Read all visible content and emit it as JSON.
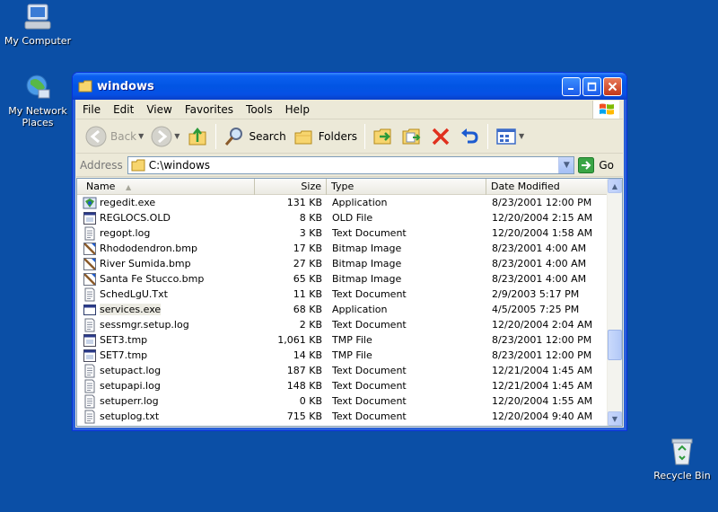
{
  "desktop": {
    "icons": [
      {
        "label": "My Computer"
      },
      {
        "label": "My Network Places"
      },
      {
        "label": "Recycle Bin"
      }
    ]
  },
  "window": {
    "title": "windows",
    "menu": [
      "File",
      "Edit",
      "View",
      "Favorites",
      "Tools",
      "Help"
    ],
    "toolbar": {
      "back_label": "Back",
      "search_label": "Search",
      "folders_label": "Folders"
    },
    "address": {
      "label": "Address",
      "value": "C:\\windows",
      "go_label": "Go"
    },
    "columns": [
      "Name",
      "Size",
      "Type",
      "Date Modified"
    ],
    "files": [
      {
        "name": "regedit.exe",
        "size": "131 KB",
        "type": "Application",
        "date": "8/23/2001 12:00 PM",
        "icon": "app-icon"
      },
      {
        "name": "REGLOCS.OLD",
        "size": "8 KB",
        "type": "OLD File",
        "date": "12/20/2004 2:15 AM",
        "icon": "file-icon"
      },
      {
        "name": "regopt.log",
        "size": "3 KB",
        "type": "Text Document",
        "date": "12/20/2004 1:58 AM",
        "icon": "text-file-icon"
      },
      {
        "name": "Rhododendron.bmp",
        "size": "17 KB",
        "type": "Bitmap Image",
        "date": "8/23/2001 4:00 AM",
        "icon": "bitmap-icon"
      },
      {
        "name": "River Sumida.bmp",
        "size": "27 KB",
        "type": "Bitmap Image",
        "date": "8/23/2001 4:00 AM",
        "icon": "bitmap-icon"
      },
      {
        "name": "Santa Fe Stucco.bmp",
        "size": "65 KB",
        "type": "Bitmap Image",
        "date": "8/23/2001 4:00 AM",
        "icon": "bitmap-icon"
      },
      {
        "name": "SchedLgU.Txt",
        "size": "11 KB",
        "type": "Text Document",
        "date": "2/9/2003 5:17 PM",
        "icon": "text-file-icon"
      },
      {
        "name": "services.exe",
        "size": "68 KB",
        "type": "Application",
        "date": "4/5/2005 7:25 PM",
        "icon": "window-app-icon"
      },
      {
        "name": "sessmgr.setup.log",
        "size": "2 KB",
        "type": "Text Document",
        "date": "12/20/2004 2:04 AM",
        "icon": "text-file-icon"
      },
      {
        "name": "SET3.tmp",
        "size": "1,061 KB",
        "type": "TMP File",
        "date": "8/23/2001 12:00 PM",
        "icon": "file-icon"
      },
      {
        "name": "SET7.tmp",
        "size": "14 KB",
        "type": "TMP File",
        "date": "8/23/2001 12:00 PM",
        "icon": "file-icon"
      },
      {
        "name": "setupact.log",
        "size": "187 KB",
        "type": "Text Document",
        "date": "12/21/2004 1:45 AM",
        "icon": "text-file-icon"
      },
      {
        "name": "setupapi.log",
        "size": "148 KB",
        "type": "Text Document",
        "date": "12/21/2004 1:45 AM",
        "icon": "text-file-icon"
      },
      {
        "name": "setuperr.log",
        "size": "0 KB",
        "type": "Text Document",
        "date": "12/20/2004 1:55 AM",
        "icon": "text-file-icon"
      },
      {
        "name": "setuplog.txt",
        "size": "715 KB",
        "type": "Text Document",
        "date": "12/20/2004 9:40 AM",
        "icon": "text-file-icon"
      }
    ],
    "selected_file": "services.exe"
  },
  "colors": {
    "desktop": "#0b4fa6",
    "titlebar": "#0255e3",
    "window_face": "#ece9d8"
  }
}
